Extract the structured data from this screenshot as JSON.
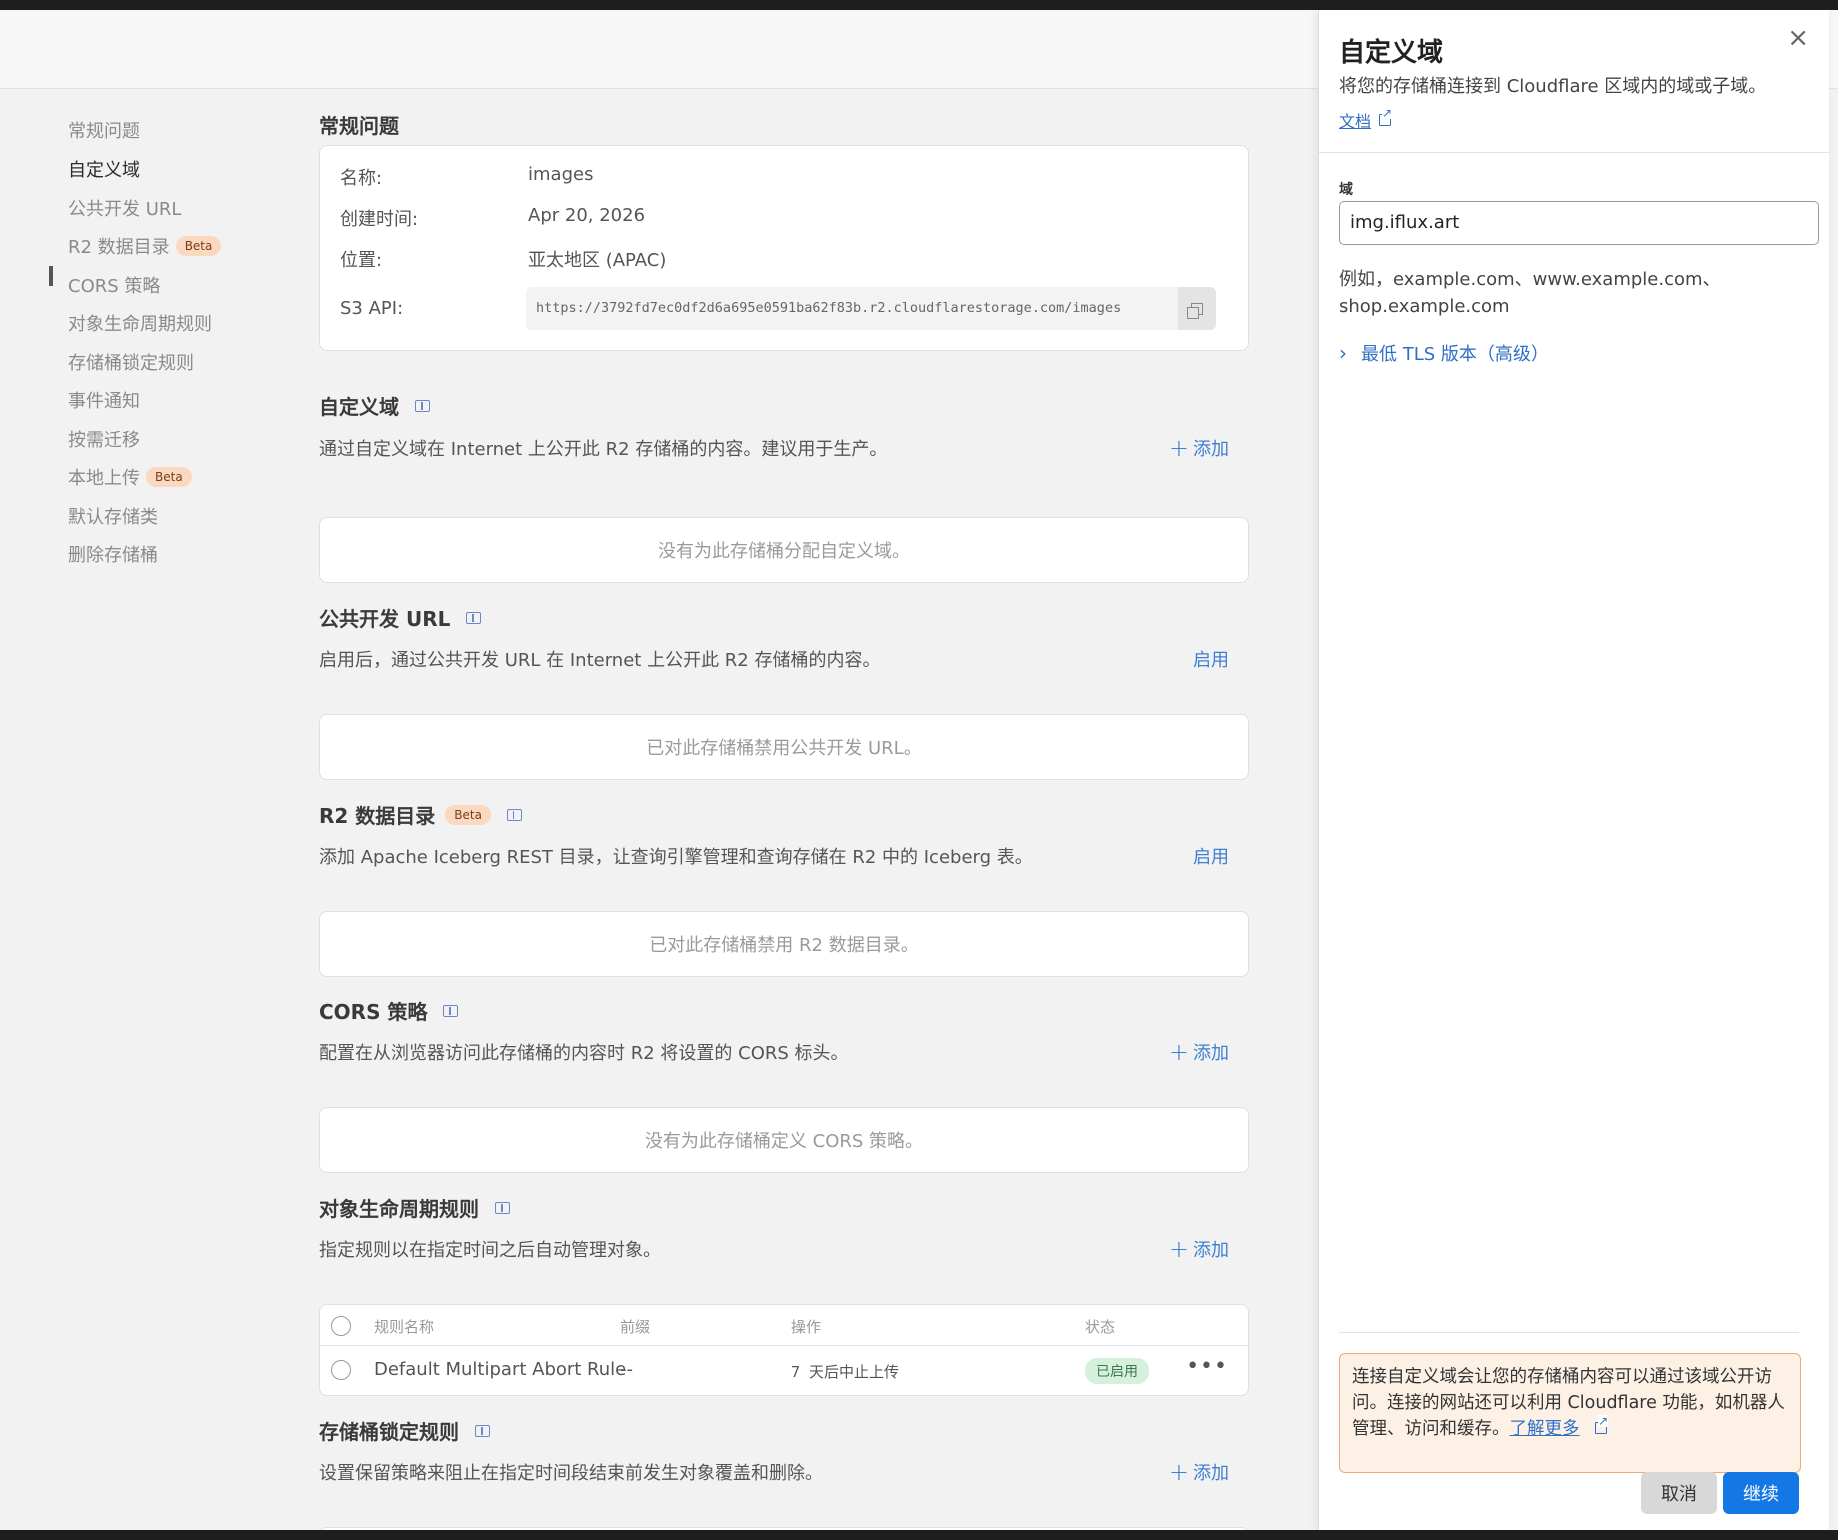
{
  "nav": {
    "items": [
      {
        "label": "常规问题"
      },
      {
        "label": "自定义域"
      },
      {
        "label": "公共开发 URL"
      },
      {
        "label": "R2 数据目录",
        "badge": "Beta"
      },
      {
        "label": "CORS 策略"
      },
      {
        "label": "对象生命周期规则"
      },
      {
        "label": "存储桶锁定规则"
      },
      {
        "label": "事件通知"
      },
      {
        "label": "按需迁移"
      },
      {
        "label": "本地上传",
        "badge": "Beta"
      },
      {
        "label": "默认存储类"
      },
      {
        "label": "删除存储桶"
      }
    ],
    "active_index": 1
  },
  "general": {
    "title": "常规问题",
    "name_label": "名称:",
    "name_value": "images",
    "created_label": "创建时间:",
    "created_value": "Apr 20, 2026",
    "location_label": "位置:",
    "location_value": "亚太地区 (APAC)",
    "s3_label": "S3 API:",
    "s3_value": "https://3792fd7ec0df2d6a695e0591ba62f83b.r2.cloudflarestorage.com/images"
  },
  "custom_domain": {
    "title": "自定义域",
    "desc": "通过自定义域在 Internet 上公开此 R2 存储桶的内容。建议用于生产。",
    "action": "添加",
    "empty": "没有为此存储桶分配自定义域。"
  },
  "public_url": {
    "title": "公共开发 URL",
    "desc": "启用后，通过公共开发 URL 在 Internet 上公开此 R2 存储桶的内容。",
    "action": "启用",
    "empty": "已对此存储桶禁用公共开发 URL。"
  },
  "data_catalog": {
    "title": "R2 数据目录",
    "badge": "Beta",
    "desc": "添加 Apache Iceberg REST 目录，让查询引擎管理和查询存储在 R2 中的 Iceberg 表。",
    "action": "启用",
    "empty": "已对此存储桶禁用 R2 数据目录。"
  },
  "cors": {
    "title": "CORS 策略",
    "desc": "配置在从浏览器访问此存储桶的内容时 R2 将设置的 CORS 标头。",
    "action": "添加",
    "empty": "没有为此存储桶定义 CORS 策略。"
  },
  "lifecycle": {
    "title": "对象生命周期规则",
    "desc": "指定规则以在指定时间之后自动管理对象。",
    "action": "添加",
    "columns": [
      "规则名称",
      "前缀",
      "操作",
      "状态"
    ],
    "rows": [
      {
        "name": "Default Multipart Abort Rule",
        "prefix": "--",
        "action": "7 天后中止上传",
        "status": "已启用",
        "menu": "•••"
      }
    ]
  },
  "lock": {
    "title": "存储桶锁定规则",
    "desc": "设置保留策略来阻止在指定时间段结束前发生对象覆盖和删除。",
    "action": "添加"
  },
  "drawer": {
    "close": "×",
    "title": "自定义域",
    "subtitle": "将您的存储桶连接到 Cloudflare 区域内的域或子域。",
    "doc_link": "文档",
    "field_label": "域",
    "field_value": "img.iflux.art",
    "hint": "例如，example.com、www.example.com、shop.example.com",
    "advanced": "最低 TLS 版本（高级）",
    "warning_text": "连接自定义域会让您的存储桶内容可以通过该域公开访问。连接的网站还可以利用 Cloudflare 功能，如机器人管理、访问和缓存。",
    "warning_link": "了解更多",
    "cancel": "取消",
    "continue": "继续"
  },
  "colors": {
    "accent": "#1477e6",
    "link": "#3e7fd3",
    "badge_bg": "#fbd9c0",
    "status_enabled_bg": "#d6f0dc",
    "warning_border": "#f0a972"
  }
}
